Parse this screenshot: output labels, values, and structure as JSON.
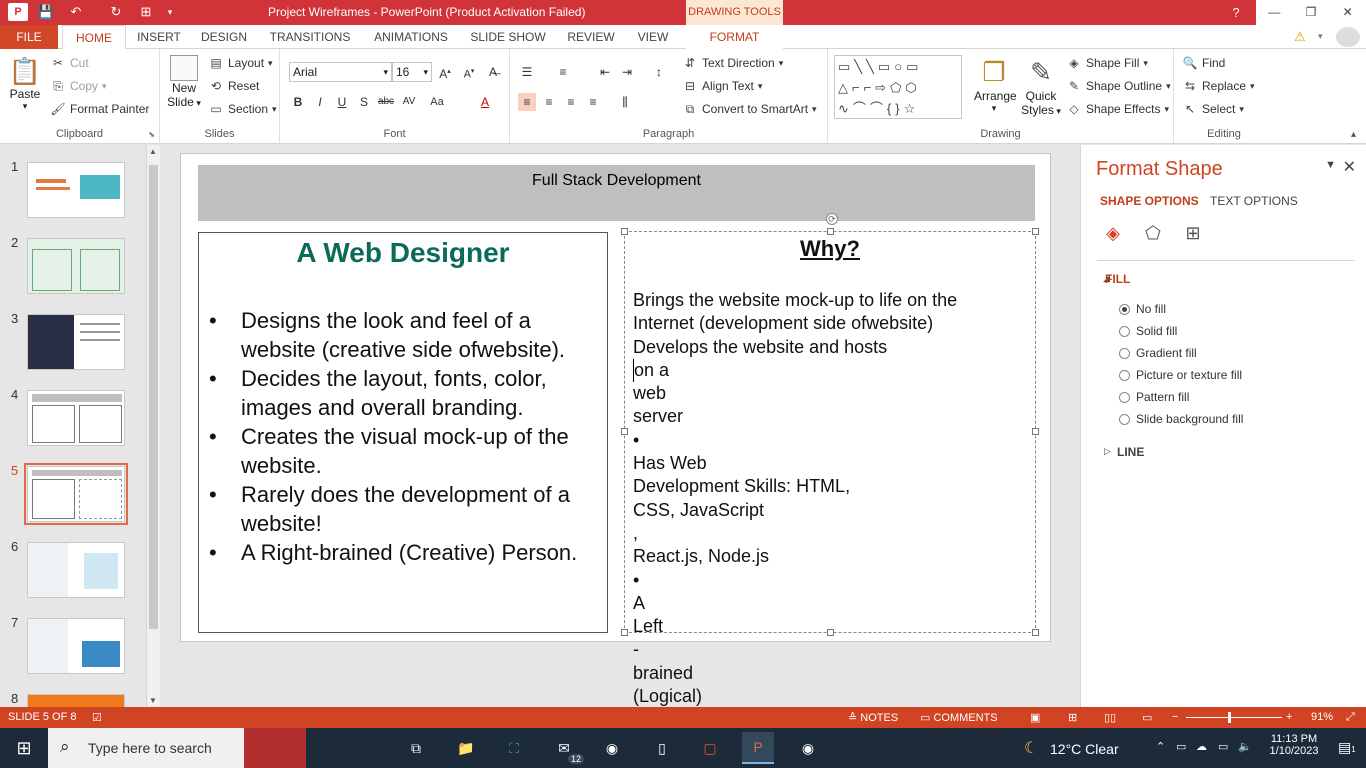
{
  "titlebar": {
    "title": "Project Wireframes -  PowerPoint (Product Activation Failed)",
    "contextual_label": "DRAWING TOOLS",
    "window_controls": [
      "?",
      "⧉",
      "—",
      "❐",
      "✕"
    ]
  },
  "tabs": [
    "FILE",
    "HOME",
    "INSERT",
    "DESIGN",
    "TRANSITIONS",
    "ANIMATIONS",
    "SLIDE SHOW",
    "REVIEW",
    "VIEW",
    "FORMAT"
  ],
  "ribbon": {
    "clipboard": {
      "label": "Clipboard",
      "paste": "Paste",
      "cut": "Cut",
      "copy": "Copy",
      "format_painter": "Format Painter"
    },
    "slides": {
      "label": "Slides",
      "new_slide": "New",
      "new_slide2": "Slide",
      "layout": "Layout",
      "reset": "Reset",
      "section": "Section"
    },
    "font": {
      "label": "Font",
      "font_name": "Arial",
      "font_size": "16"
    },
    "paragraph": {
      "label": "Paragraph",
      "text_direction": "Text Direction",
      "align_text": "Align Text",
      "convert_smartart": "Convert to SmartArt"
    },
    "drawing": {
      "label": "Drawing",
      "arrange": "Arrange",
      "quick_styles": "Quick",
      "quick_styles2": "Styles",
      "shape_fill": "Shape Fill",
      "shape_outline": "Shape Outline",
      "shape_effects": "Shape Effects"
    },
    "editing": {
      "label": "Editing",
      "find": "Find",
      "replace": "Replace",
      "select": "Select"
    }
  },
  "thumbnails": [
    {
      "num": "1"
    },
    {
      "num": "2"
    },
    {
      "num": "3"
    },
    {
      "num": "4"
    },
    {
      "num": "5"
    },
    {
      "num": "6"
    },
    {
      "num": "7"
    },
    {
      "num": "8"
    }
  ],
  "slide": {
    "header": "Full Stack Development",
    "left_title": "A Web Designer",
    "left_items": [
      "Designs the look and feel of a website (creative side ofwebsite).",
      "Decides the layout, fonts, color, images and overall branding.",
      "Creates the visual mock-up of the website.",
      "Rarely does the development of a website!",
      "A Right-brained (Creative) Person."
    ],
    "right_title": "Why?",
    "right_lines": [
      "Brings the website mock-up to life on the",
      "Internet (development side ofwebsite)",
      "Develops the website and hosts",
      "on a",
      "web",
      "server",
      "•",
      "Has Web",
      "Development Skills: HTML,",
      "CSS, JavaScript",
      ",",
      "React.js, Node.js",
      "•",
      "A",
      "Left",
      "-",
      "brained",
      "(Logical)"
    ]
  },
  "format_pane": {
    "title": "Format Shape",
    "shape_options": "SHAPE OPTIONS",
    "text_options": "TEXT OPTIONS",
    "fill": "FILL",
    "fill_options": [
      "No fill",
      "Solid fill",
      "Gradient fill",
      "Picture or texture fill",
      "Pattern fill",
      "Slide background fill"
    ],
    "line": "LINE"
  },
  "statusbar": {
    "slide_info": "SLIDE 5 OF 8",
    "notes": "NOTES",
    "comments": "COMMENTS",
    "zoom": "91%"
  },
  "taskbar": {
    "search_placeholder": "Type here to search",
    "weather": "12°C  Clear",
    "time": "11:13 PM",
    "date": "1/10/2023",
    "mail_badge": "12",
    "notif_badge": "1"
  }
}
